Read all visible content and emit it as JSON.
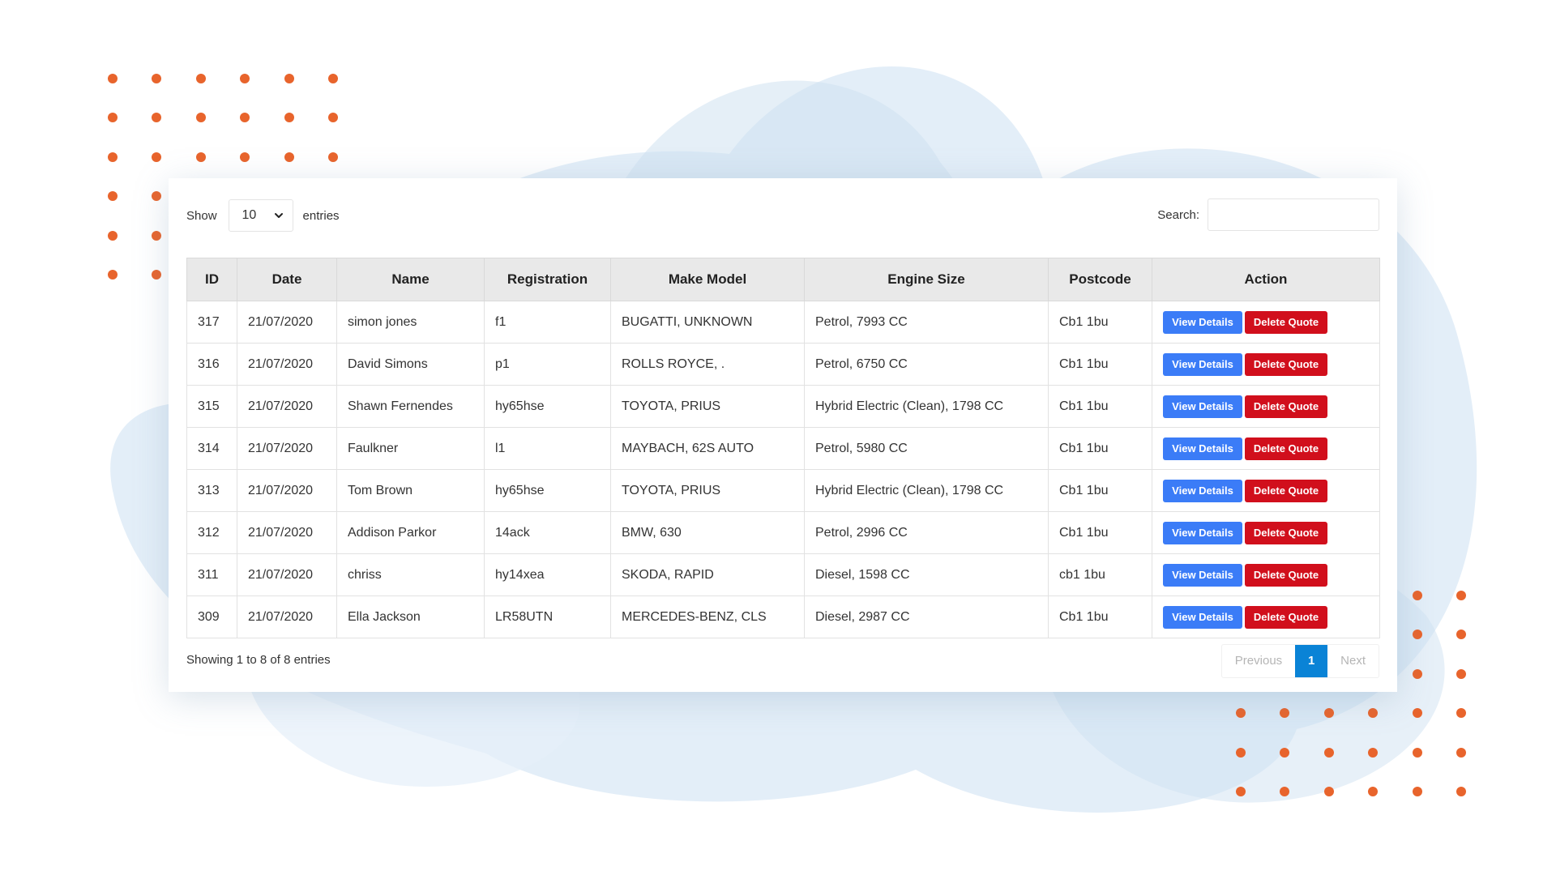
{
  "controls": {
    "show_label": "Show",
    "page_length": "10",
    "entries_label": "entries",
    "search_label": "Search:",
    "search_value": ""
  },
  "table": {
    "headers": [
      "ID",
      "Date",
      "Name",
      "Registration",
      "Make Model",
      "Engine Size",
      "Postcode",
      "Action"
    ],
    "rows": [
      {
        "id": "317",
        "date": "21/07/2020",
        "name": "simon jones",
        "registration": "f1",
        "make_model": "BUGATTI, UNKNOWN",
        "engine": "Petrol, 7993 CC",
        "postcode": "Cb1 1bu"
      },
      {
        "id": "316",
        "date": "21/07/2020",
        "name": "David Simons",
        "registration": "p1",
        "make_model": "ROLLS ROYCE, .",
        "engine": "Petrol, 6750 CC",
        "postcode": "Cb1 1bu"
      },
      {
        "id": "315",
        "date": "21/07/2020",
        "name": "Shawn Fernendes",
        "registration": "hy65hse",
        "make_model": "TOYOTA, PRIUS",
        "engine": "Hybrid Electric (Clean), 1798 CC",
        "postcode": "Cb1 1bu"
      },
      {
        "id": "314",
        "date": "21/07/2020",
        "name": "Faulkner",
        "registration": "l1",
        "make_model": "MAYBACH, 62S AUTO",
        "engine": "Petrol, 5980 CC",
        "postcode": "Cb1 1bu"
      },
      {
        "id": "313",
        "date": "21/07/2020",
        "name": "Tom Brown",
        "registration": "hy65hse",
        "make_model": "TOYOTA, PRIUS",
        "engine": "Hybrid Electric (Clean), 1798 CC",
        "postcode": "Cb1 1bu"
      },
      {
        "id": "312",
        "date": "21/07/2020",
        "name": "Addison Parkor",
        "registration": "14ack",
        "make_model": "BMW, 630",
        "engine": "Petrol, 2996 CC",
        "postcode": "Cb1 1bu"
      },
      {
        "id": "311",
        "date": "21/07/2020",
        "name": "chriss",
        "registration": "hy14xea",
        "make_model": "SKODA, RAPID",
        "engine": "Diesel, 1598 CC",
        "postcode": "cb1 1bu"
      },
      {
        "id": "309",
        "date": "21/07/2020",
        "name": "Ella Jackson",
        "registration": "LR58UTN",
        "make_model": "MERCEDES-BENZ, CLS",
        "engine": "Diesel, 2987 CC",
        "postcode": "Cb1 1bu"
      }
    ],
    "view_label": "View Details",
    "delete_label": "Delete Quote"
  },
  "footer": {
    "info": "Showing 1 to 8 of 8 entries",
    "previous": "Previous",
    "current_page": "1",
    "next": "Next"
  },
  "colors": {
    "view_button": "#3b7cf7",
    "delete_button": "#d10f1c",
    "active_page": "#0a83d6",
    "decor_dots": "#e8642c",
    "decor_blobs": "#dceaf6"
  }
}
